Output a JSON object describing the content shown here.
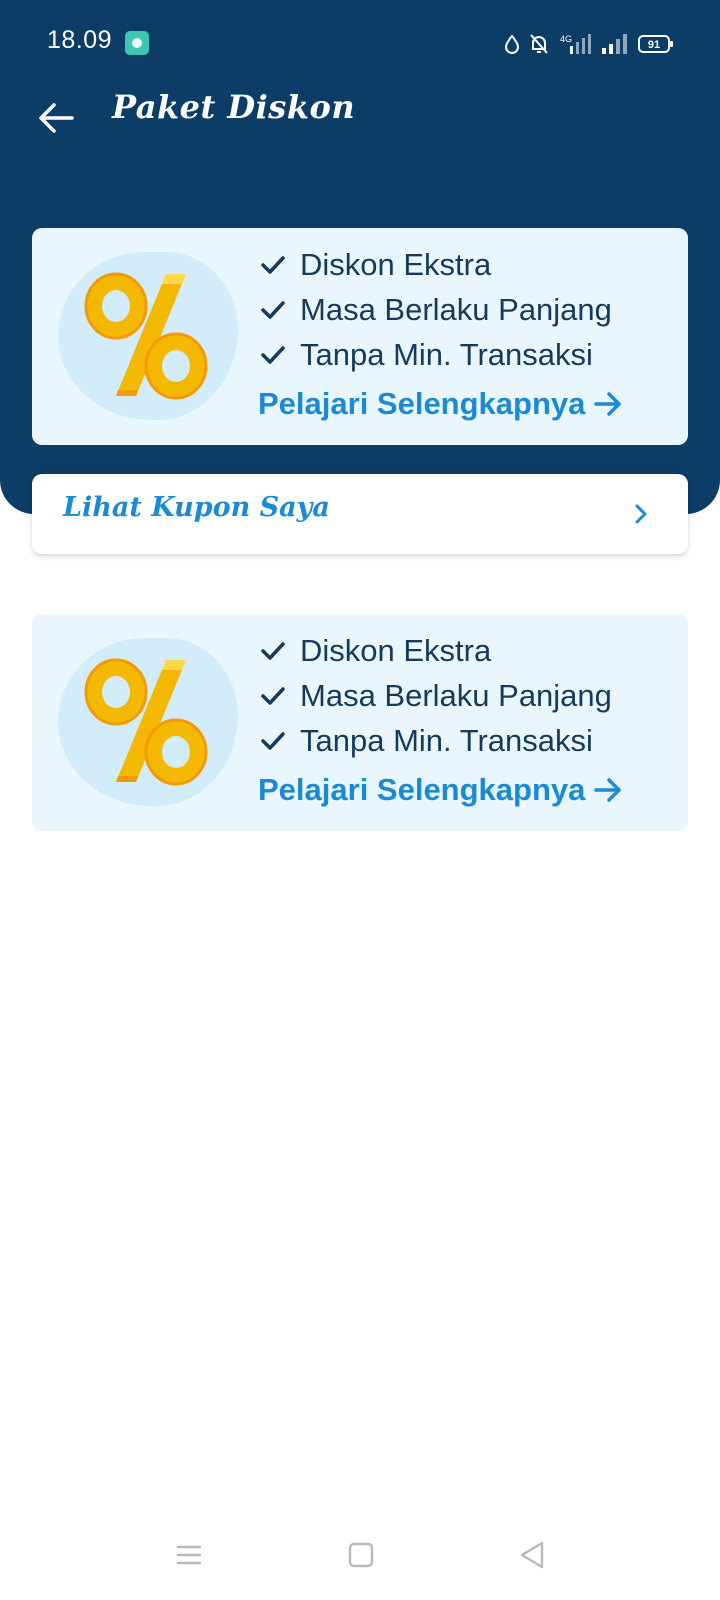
{
  "status_bar": {
    "time": "18.09",
    "network": "4G",
    "battery": "91"
  },
  "app_bar": {
    "title": "Paket Diskon",
    "back_icon": "arrow-left-icon"
  },
  "colors": {
    "header": "#0b3d66",
    "card_bg": "#e9f6fd",
    "accent": "#1b8ad6",
    "text_dark": "#163a5c",
    "percent_gold": "#f5b800"
  },
  "promo_cards": [
    {
      "icon": "percent-icon",
      "features": [
        "Diskon Ekstra",
        "Masa Berlaku Panjang",
        "Tanpa Min. Transaksi"
      ],
      "cta": "Pelajari Selengkapnya"
    },
    {
      "icon": "percent-icon",
      "features": [
        "Diskon Ekstra",
        "Masa Berlaku Panjang",
        "Tanpa Min. Transaksi"
      ],
      "cta": "Pelajari Selengkapnya"
    }
  ],
  "coupon_link": {
    "label": "Lihat Kupon Saya",
    "icon": "chevron-right-icon"
  },
  "nav_bar": {
    "icons": [
      "menu-icon",
      "home-square-icon",
      "back-triangle-icon"
    ]
  }
}
